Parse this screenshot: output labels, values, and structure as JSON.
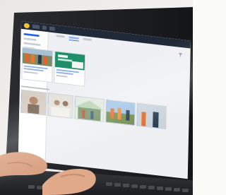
{
  "scene": {
    "subject": "laptop-screen",
    "colors": {
      "wall": "#fbfbfa",
      "bezel": "#1b1c1f",
      "keyboard": "#2a2b2e",
      "skin": "#e0a98a",
      "accent": "#2563eb",
      "card_bg": "#ffffff",
      "app_bg": "#eef0f3"
    }
  },
  "app": {
    "icons": [
      "logo-icon",
      "filter-icon"
    ]
  }
}
